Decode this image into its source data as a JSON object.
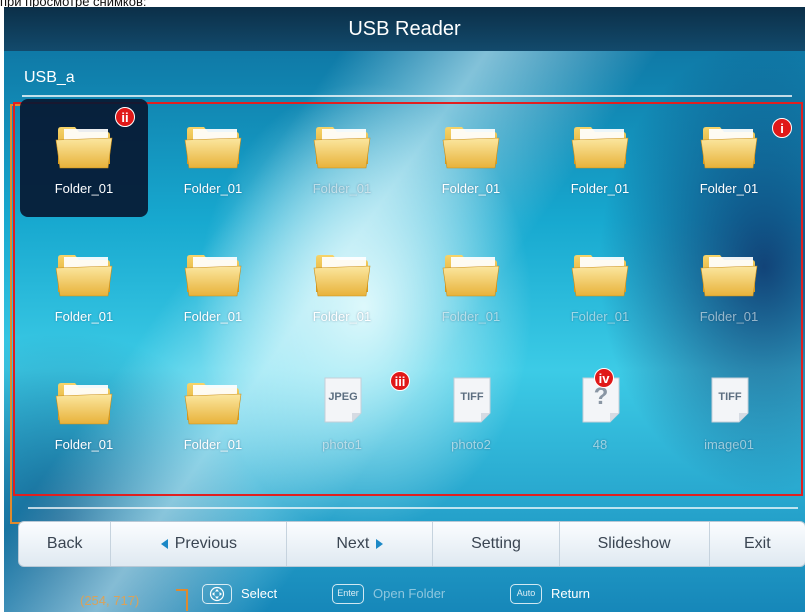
{
  "caption_fragment": "при просмотре снимков:",
  "app": {
    "title": "USB Reader",
    "path": "USB_a"
  },
  "grid": {
    "items": [
      {
        "name": "Folder_01",
        "kind": "folder",
        "selected": true
      },
      {
        "name": "Folder_01",
        "kind": "folder"
      },
      {
        "name": "Folder_01",
        "kind": "folder",
        "faint": true
      },
      {
        "name": "Folder_01",
        "kind": "folder"
      },
      {
        "name": "Folder_01",
        "kind": "folder"
      },
      {
        "name": "Folder_01",
        "kind": "folder"
      },
      {
        "name": "Folder_01",
        "kind": "folder"
      },
      {
        "name": "Folder_01",
        "kind": "folder"
      },
      {
        "name": "Folder_01",
        "kind": "folder"
      },
      {
        "name": "Folder_01",
        "kind": "folder",
        "faint": true
      },
      {
        "name": "Folder_01",
        "kind": "folder",
        "faint": true
      },
      {
        "name": "Folder_01",
        "kind": "folder",
        "faint": true
      },
      {
        "name": "Folder_01",
        "kind": "folder"
      },
      {
        "name": "Folder_01",
        "kind": "folder"
      },
      {
        "name": "photo1",
        "kind": "file",
        "type_label": "JPEG",
        "faint": true
      },
      {
        "name": "photo2",
        "kind": "file",
        "type_label": "TIFF",
        "faint": true
      },
      {
        "name": "48",
        "kind": "unknown",
        "type_label": "?",
        "faint": true
      },
      {
        "name": "image01",
        "kind": "file",
        "type_label": "TIFF",
        "faint": true
      }
    ]
  },
  "callouts": {
    "i": "i",
    "ii": "ii",
    "iii": "iii",
    "iv": "iv"
  },
  "buttons": {
    "back": "Back",
    "previous": "Previous",
    "next": "Next",
    "setting": "Setting",
    "slideshow": "Slideshow",
    "exit": "Exit"
  },
  "hints": {
    "coords": "(254, 717)",
    "select_label": "Select",
    "enter_key": "Enter",
    "open_folder_label": "Open Folder",
    "auto_key": "Auto",
    "return_label": "Return"
  },
  "colors": {
    "annotation_red": "#e02020",
    "annotation_orange": "#e08a2e",
    "accent_blue": "#1b88c6"
  }
}
